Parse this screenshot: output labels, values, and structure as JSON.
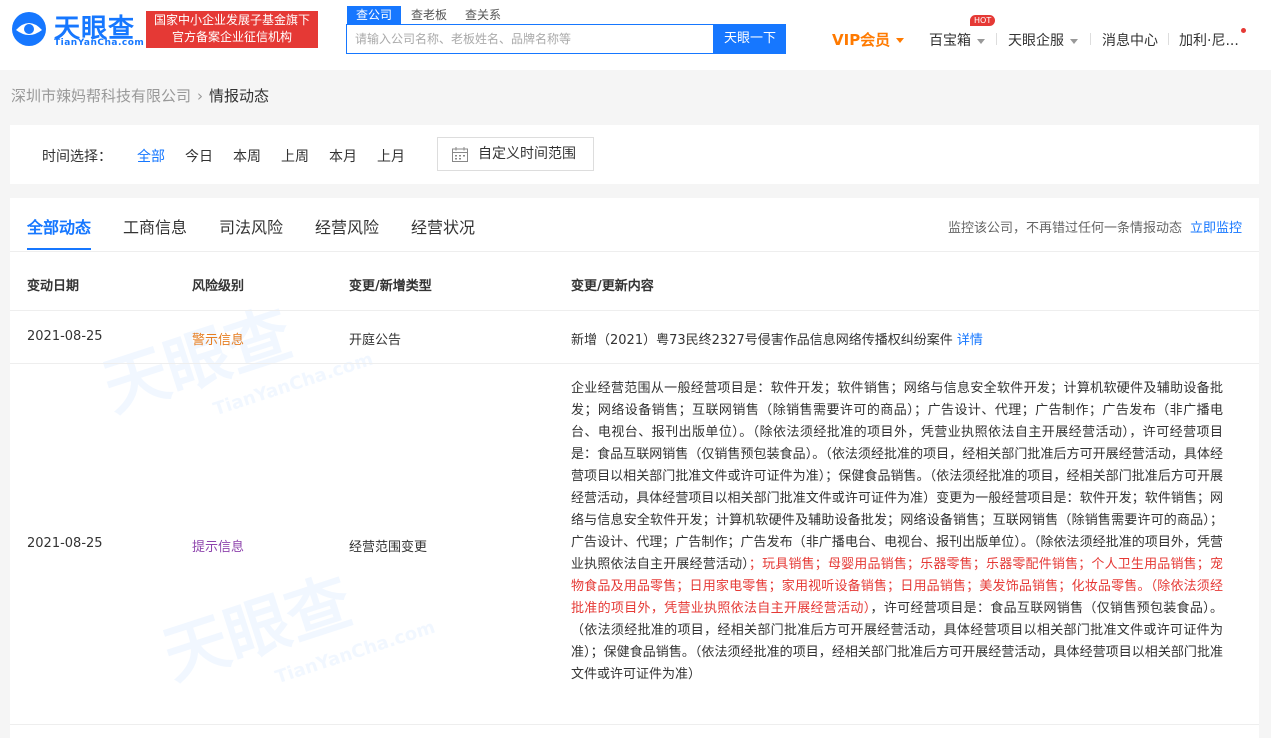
{
  "brand": {
    "name": "天眼查",
    "domain": "TianYanCha.com",
    "slogan_line1": "国家中小企业发展子基金旗下",
    "slogan_line2": "官方备案企业征信机构",
    "watermark": "天眼查",
    "watermark_sub": "TianYanCha.com",
    "color": "#1677ff"
  },
  "search": {
    "tabs": [
      "查公司",
      "查老板",
      "查关系"
    ],
    "active_tab": "查公司",
    "placeholder": "请输入公司名称、老板姓名、品牌名称等",
    "value": "",
    "button": "天眼一下"
  },
  "nav": {
    "vip": "VIP会员",
    "treasure": "百宝箱",
    "hot": "HOT",
    "enterprise": "天眼企服",
    "messages": "消息中心",
    "user": "加利·尼..."
  },
  "breadcrumb": {
    "company": "深圳市辣妈帮科技有限公司",
    "sep": "›",
    "current": "情报动态"
  },
  "filter": {
    "label": "时间选择：",
    "options": [
      "全部",
      "今日",
      "本周",
      "上周",
      "本月",
      "上月"
    ],
    "active": "全部",
    "custom": "自定义时间范围"
  },
  "tabs": [
    "全部动态",
    "工商信息",
    "司法风险",
    "经营风险",
    "经营状况"
  ],
  "active_tab": "全部动态",
  "monitor": {
    "text": "监控该公司，不再错过任何一条情报动态",
    "link": "立即监控"
  },
  "table": {
    "headers": [
      "变动日期",
      "风险级别",
      "变更/新增类型",
      "变更/更新内容"
    ],
    "row1": {
      "date": "2021-08-25",
      "level": "警示信息",
      "type": "开庭公告",
      "content": "新增（2021）粤73民终2327号侵害作品信息网络传播权纠纷案件",
      "detail": "详情"
    },
    "row2": {
      "date": "2021-08-25",
      "level": "提示信息",
      "type": "经营范围变更",
      "content_a": "企业经营范围从一般经营项目是：软件开发；软件销售；网络与信息安全软件开发；计算机软硬件及辅助设备批发；网络设备销售；互联网销售（除销售需要许可的商品）；广告设计、代理；广告制作；广告发布（非广播电台、电视台、报刊出版单位）。（除依法须经批准的项目外，凭营业执照依法自主开展经营活动），许可经营项目是：食品互联网销售（仅销售预包装食品）。（依法须经批准的项目，经相关部门批准后方可开展经营活动，具体经营项目以相关部门批准文件或许可证件为准）；保健食品销售。（依法须经批准的项目，经相关部门批准后方可开展经营活动，具体经营项目以相关部门批准文件或许可证件为准）变更为一般经营项目是：软件开发；软件销售；网络与信息安全软件开发；计算机软硬件及辅助设备批发；网络设备销售；互联网销售（除销售需要许可的商品）；广告设计、代理；广告制作；广告发布（非广播电台、电视台、报刊出版单位）。（除依法须经批准的项目外，凭营业执照依法自主开展经营活动）",
      "content_hl": "；玩具销售；母婴用品销售；乐器零售；乐器零配件销售；个人卫生用品销售；宠物食品及用品零售；日用家电零售；家用视听设备销售；日用品销售；美发饰品销售；化妆品零售。（除依法须经批准的项目外，凭营业执照依法自主开展经营活动）",
      "content_b": "，许可经营项目是：食品互联网销售（仅销售预包装食品）。（依法须经批准的项目，经相关部门批准后方可开展经营活动，具体经营项目以相关部门批准文件或许可证件为准）；保健食品销售。（依法须经批准的项目，经相关部门批准后方可开展经营活动，具体经营项目以相关部门批准文件或许可证件为准）"
    }
  }
}
